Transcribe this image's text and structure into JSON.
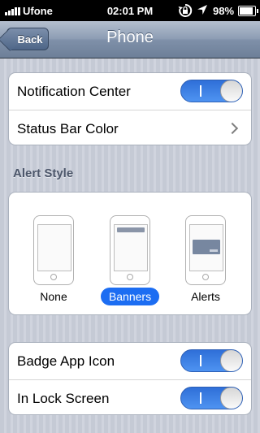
{
  "status_bar": {
    "carrier": "Ufone",
    "time": "02:01 PM",
    "battery": "98%",
    "battery_level": 0.98,
    "icons": [
      "signal-icon",
      "rotation-lock-icon",
      "location-icon",
      "battery-icon"
    ]
  },
  "nav": {
    "back_label": "Back",
    "title": "Phone"
  },
  "group1": {
    "notification_center": {
      "label": "Notification Center",
      "on": true
    },
    "status_bar_color": {
      "label": "Status Bar Color"
    }
  },
  "alert_style": {
    "header": "Alert Style",
    "options": [
      "None",
      "Banners",
      "Alerts"
    ],
    "selected": "Banners"
  },
  "group2": {
    "badge_app_icon": {
      "label": "Badge App Icon",
      "on": true
    },
    "in_lock_screen": {
      "label": "In Lock Screen",
      "on": true
    }
  },
  "colors": {
    "toggle_on": "#3a7fe6",
    "selection": "#1c6df2",
    "nav_bar": "#8d9db4"
  }
}
